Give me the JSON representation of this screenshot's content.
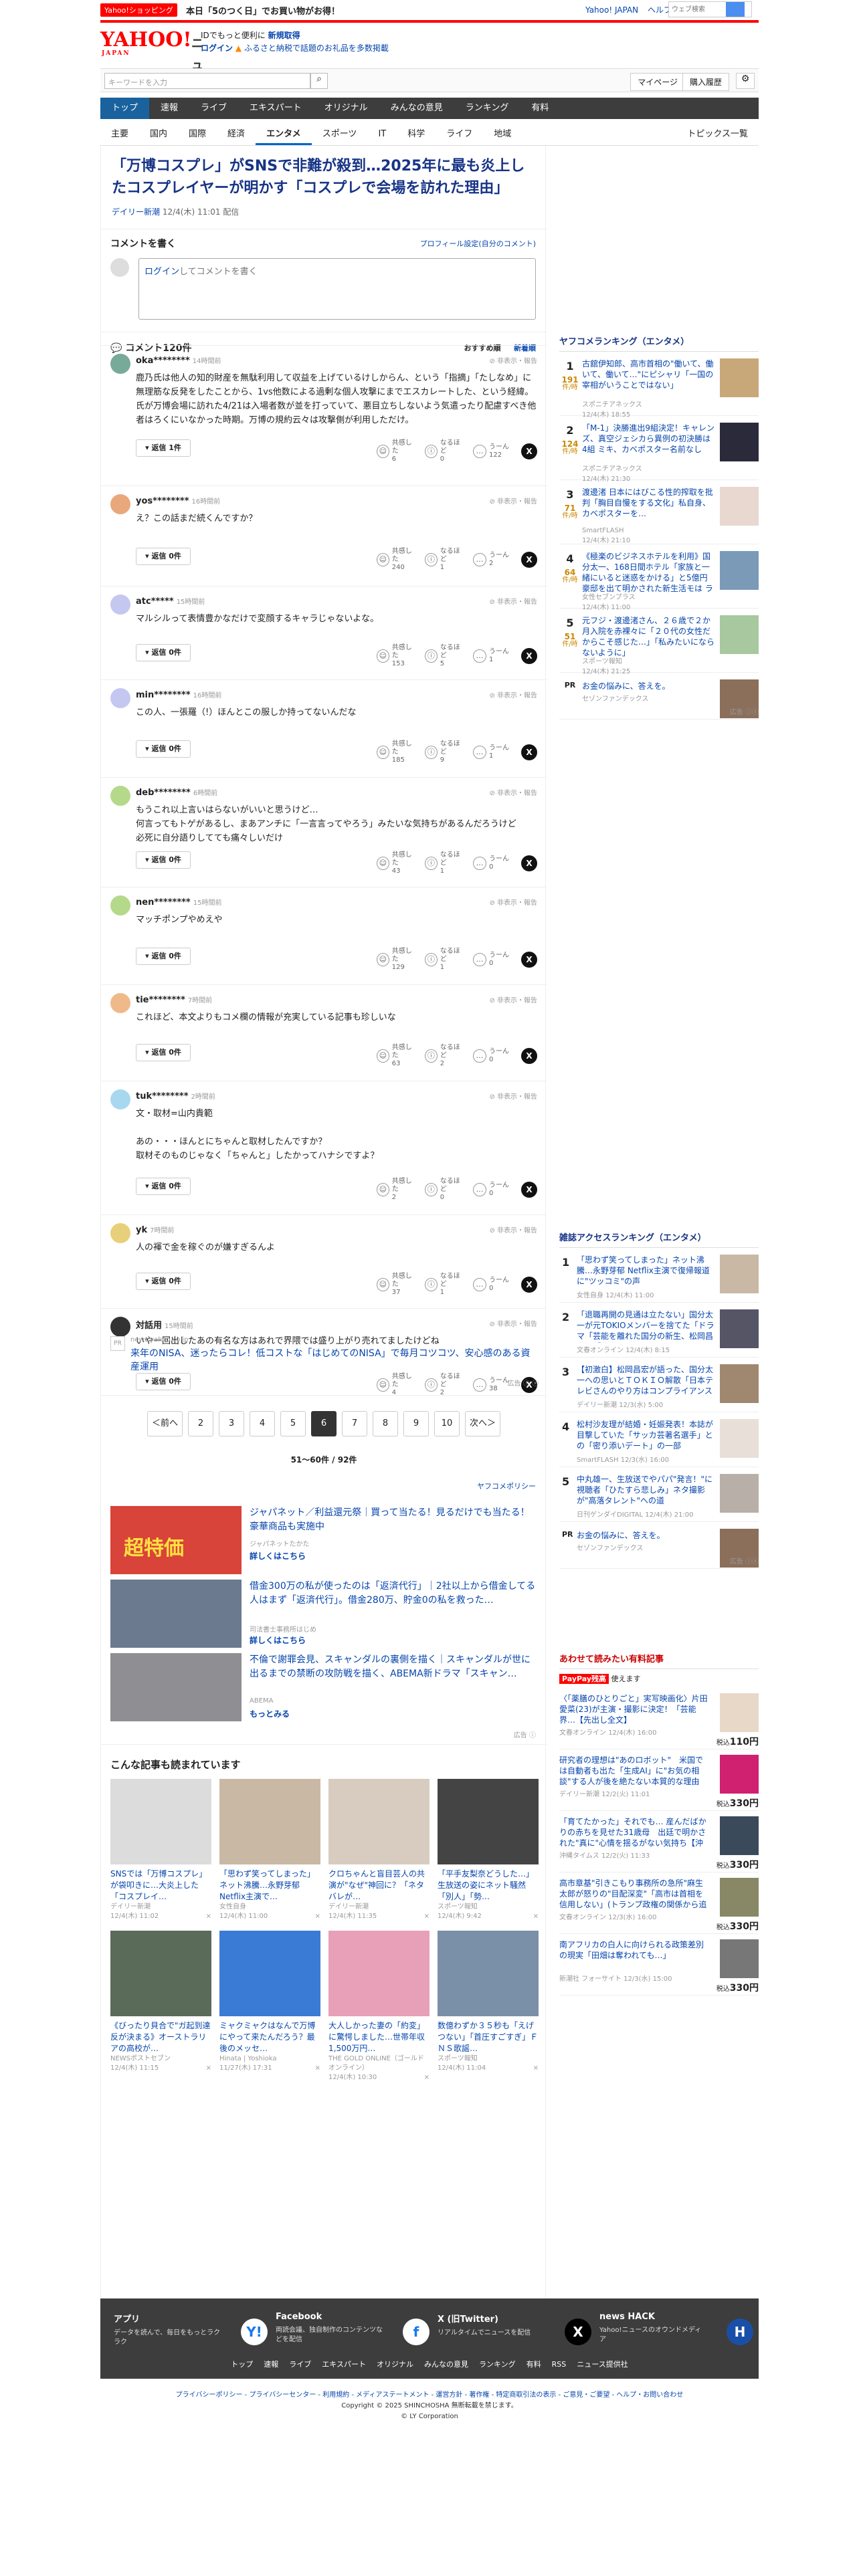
{
  "topbar": {
    "shopping_badge": "Yahoo!ショッピング",
    "shopping_text": "本日「5のつく日」でお買い物がお得！",
    "link_yahoo": "Yahoo! JAPAN",
    "link_help": "ヘルプ",
    "search_placeholder": "ウェブ検索",
    "location": "市川義範"
  },
  "logo": {
    "main": "YAHOO!",
    "sub": "JAPAN",
    "news": "ニュース"
  },
  "promo": {
    "line1a": "IDでもっと便利に",
    "line1b": "新規取得",
    "line2a": "ログイン",
    "line2b": "ふるさと納税で話題のお礼品を多数掲載"
  },
  "searchbar": {
    "placeholder": "キーワードを入力",
    "mypage": "マイページ",
    "purchased": "購入履歴"
  },
  "gnav": [
    "トップ",
    "速報",
    "ライブ",
    "エキスパート",
    "オリジナル",
    "みんなの意見",
    "ランキング",
    "有料"
  ],
  "subnav": [
    "主要",
    "国内",
    "国際",
    "経済",
    "エンタメ",
    "スポーツ",
    "IT",
    "科学",
    "ライフ",
    "地域"
  ],
  "subnav_right": "トピックス一覧",
  "article": {
    "headline": "「万博コスプレ」がSNSで非難が殺到…2025年に最も炎上したコスプレイヤーが明かす「コスプレで会場を訪れた理由」",
    "source": "デイリー新潮",
    "date": "12/4(木) 11:01 配信"
  },
  "comment_write": {
    "title": "コメントを書く",
    "profile_link": "プロフィール設定(自分のコメント)",
    "login_link": "ログイン",
    "placeholder": "してコメントを書く"
  },
  "comments_header": {
    "title": "コメント120件",
    "sort_recommended": "おすすめ順",
    "sort_new": "新着順"
  },
  "labels": {
    "report": "非表示・報告",
    "empathy": "共感した",
    "naruhodo": "なるほど",
    "hmm": "うーん"
  },
  "comments": [
    {
      "user": "oka********",
      "time": "14時間前",
      "text": "鹿乃氏は他人の知的財産を無駄利用して収益を上げているけしからん、という「指摘」「たしなめ」に無理筋な反発をしたことから、1vs他数による過剰な個人攻撃にまでエスカレートした、という経緯。氏が万博会場に訪れた4/21は入場者数が並を打っていて、悪目立ちしないよう気遣ったり配慮すべき他者はろくにいなかった時期。万博の規約云々は攻撃側が利用しただけ。",
      "reply": "返信 1件",
      "empathy": "6",
      "naruhodo": "0",
      "hmm": "122",
      "color": "#7a9"
    },
    {
      "user": "yos********",
      "time": "16時間前",
      "text": "え？この話まだ続くんですか？",
      "reply": "返信 0件",
      "empathy": "240",
      "naruhodo": "1",
      "hmm": "2",
      "color": "#e8a87c"
    },
    {
      "user": "atc*****",
      "time": "15時間前",
      "text": "マルシルって表情豊かなだけで変顔するキャラじゃないよな。",
      "reply": "返信 0件",
      "empathy": "153",
      "naruhodo": "5",
      "hmm": "1",
      "color": "#c4c8f0"
    },
    {
      "user": "min********",
      "time": "16時間前",
      "text": "この人、一張羅（!）ほんとこの服しか持ってないんだな",
      "reply": "返信 0件",
      "empathy": "185",
      "naruhodo": "9",
      "hmm": "1",
      "color": "#c4c8f0"
    },
    {
      "user": "deb********",
      "time": "6時間前",
      "text": "もうこれ以上言いはらないがいいと思うけど…\n何言ってもトゲがあるし、まあアンチに「一言言ってやろう」みたいな気持ちがあるんだろうけど\n必死に自分語りしてても痛々しいだけ",
      "reply": "返信 0件",
      "empathy": "43",
      "naruhodo": "1",
      "hmm": "0",
      "color": "#b5d98a"
    },
    {
      "user": "nen********",
      "time": "15時間前",
      "text": "マッチポンプやめえや",
      "reply": "返信 0件",
      "empathy": "129",
      "naruhodo": "1",
      "hmm": "0",
      "color": "#b5d98a"
    },
    {
      "user": "tie********",
      "time": "7時間前",
      "text": "これほど、本文よりもコメ欄の情報が充実している記事も珍しいな",
      "reply": "返信 0件",
      "empathy": "63",
      "naruhodo": "2",
      "hmm": "0",
      "color": "#f0b98a"
    },
    {
      "user": "tuk********",
      "time": "2時間前",
      "text": "文・取材=山内貴範\n\nあの・・・ほんとにちゃんと取材したんですか？\n取材そのものじゃなく「ちゃんと」したかってハナシですよ？",
      "reply": "返信 0件",
      "empathy": "2",
      "naruhodo": "0",
      "hmm": "0",
      "color": "#a8d8f0"
    },
    {
      "user": "yk",
      "time": "7時間前",
      "text": "人の褌で金を稼ぐのが嫌すぎるんよ",
      "reply": "返信 0件",
      "empathy": "37",
      "naruhodo": "1",
      "hmm": "0",
      "color": "#e8d07a"
    },
    {
      "user": "対話用",
      "time": "15時間前",
      "text": "いや一回出したあの有名な方はあれで界隈では盛り上がり売れてましたけどね",
      "reply": "返信 0件",
      "empathy": "4",
      "naruhodo": "2",
      "hmm": "38",
      "color": "#333"
    }
  ],
  "inline_ad": {
    "domain": "news.yahoo.co.jp",
    "text": "来年のNISA、迷ったらコレ！低コストな「はじめてのNISA」で毎月コツコツ、安心感のある資産運用",
    "label": "広告"
  },
  "pager": {
    "prev": "＜前へ",
    "pages": [
      "2",
      "3",
      "4",
      "5",
      "6",
      "7",
      "8",
      "9",
      "10"
    ],
    "current": "6",
    "next": "次へ＞",
    "count": "51〜60件 / 92件"
  },
  "ad_policy": "ヤフコメポリシー",
  "ads": [
    {
      "title": "ジャパネット／利益還元祭｜買って当たる！見るだけでも当たる！豪華商品も実施中",
      "source": "ジャパネットたかた",
      "link": "詳しくはこちら",
      "banner": "超特価",
      "color": "#d8433a"
    },
    {
      "title": "借金300万の私が使ったのは「返済代行」｜2社以上から借金してる人はまず「返済代行」。借金280万、貯金0の私を救った…",
      "source": "司法書士事務所はじめ",
      "link": "詳しくはこちら",
      "color": "#6b7a8f"
    },
    {
      "title": "不倫で謝罪会見、スキャンダルの裏側を描く｜スキャンダルが世に出るまでの禁断の攻防戦を描く、ABEMA新ドラマ「スキャン…",
      "source": "ABEMA",
      "link": "もっとみる",
      "color": "#8e8e93"
    }
  ],
  "recommended": {
    "title": "こんな記事も読まれています",
    "items": [
      {
        "title": "SNSでは「万博コスプレ」が袋叩きに…大炎上した「コスプレイ…",
        "source": "デイリー新潮",
        "date": "12/4(木) 11:02",
        "color": "#dcdcdc"
      },
      {
        "title": "「思わず笑ってしまった」ネット沸騰…永野芽郁 Netflix主演で…",
        "source": "女性自身",
        "date": "12/4(木) 11:00",
        "color": "#c9b8a4"
      },
      {
        "title": "クロちゃんと盲目芸人の共演が\"なぜ\"神回に？「ネタバレが…",
        "source": "デイリー新潮",
        "date": "12/4(木) 11:35",
        "color": "#d8ccc0"
      },
      {
        "title": "「平手友梨奈どうした…」生放送の姿にネット騒然「別人」「勢…",
        "source": "スポーツ報知",
        "date": "12/4(木) 9:42",
        "color": "#444"
      },
      {
        "title": "《びったり貝合で\"ガ起到達反が決まる》オーストラリアの高校が…",
        "source": "NEWSポストセブン",
        "date": "12/4(木) 11:15",
        "color": "#5a6b5a"
      },
      {
        "title": "ミャクミャクはなんで万博にやって来たんだろう？最後のメッセ…",
        "source": "Hinata | Yoshioka",
        "date": "11/27(木) 17:31",
        "color": "#3a7bd5"
      },
      {
        "title": "大人しかった妻の「約変」に驚愕しました…世帯年収1,500万円…",
        "source": "THE GOLD ONLINE（ゴールドオンライン）",
        "date": "12/4(木) 10:30",
        "color": "#e8a0b8"
      },
      {
        "title": "数億わずか３５秒も「えげつない」「首圧すごすぎ」ＦＮＳ歌謡…",
        "source": "スポーツ報知",
        "date": "12/4(木) 11:04",
        "color": "#7a8fa8"
      }
    ]
  },
  "ranking": {
    "title": "ヤフコメランキング（エンタメ）",
    "items": [
      {
        "num": "1",
        "count": "191",
        "unit": "件/時",
        "title": "古舘伊知郎、高市首相の\"働いて、働いて、働いて…\"にピシャリ「一国の宰相がいうことではない」",
        "source": "スポニチアネックス",
        "date": "12/4(木) 18:55",
        "color": "#c8a878"
      },
      {
        "num": "2",
        "count": "124",
        "unit": "件/時",
        "title": "「M-1」決勝進出9組決定！キャレンズ、真空ジェシカら異例の初決勝は4組 ミキ、カベポスター名前なし",
        "source": "スポニチアネックス",
        "date": "12/4(木) 21:30",
        "color": "#2a2a3a"
      },
      {
        "num": "3",
        "count": "71",
        "unit": "件/時",
        "title": "渡邊渚 日本にはびこる性的搾取を批判「胸目自慢をする文化」私自身、カベポスターを…",
        "source": "SmartFLASH",
        "date": "12/4(木) 21:10",
        "color": "#e8d8d0"
      },
      {
        "num": "4",
        "count": "64",
        "unit": "件/時",
        "title": "《極楽のビジネスホテルを利用》国分太一、168日間ホテル「家族と一緒にいると迷惑をかける」と5億円豪邸を出て明かされた新生活モは ラブホ街での目撃情報も",
        "source": "女性セブンプラス",
        "date": "12/4(木) 11:00",
        "color": "#7a9ab8"
      },
      {
        "num": "5",
        "count": "51",
        "unit": "件/時",
        "title": "元フジ・渡邊渚さん、２６歳で２か月入院を赤裸々に「２０代の女性だからこそ感じた…」「私みたいにならないように」",
        "source": "スポーツ報知",
        "date": "12/4(木) 21:25",
        "color": "#a8c8a0"
      }
    ],
    "pr": {
      "title": "お金の悩みに、答えを。",
      "source": "セゾンファンデックス",
      "label": "PR",
      "ad": "広告"
    }
  },
  "magazine": {
    "title": "雑誌アクセスランキング（エンタメ）",
    "items": [
      {
        "num": "1",
        "title": "「思わず笑ってしまった」ネット沸騰…永野芽郁 Netflix主演で復帰報道に\"ツッコミ\"の声",
        "source": "女性自身",
        "date": "12/4(木) 11:00",
        "color": "#c9b8a4"
      },
      {
        "num": "2",
        "title": "「退職再開の見通は立たない」国分太一が元TOKIOメンバーを捨てた「ドラマ「芸能を離れた国分の新生、松岡昌宏は「将来のことを…",
        "source": "文春オンライン",
        "date": "12/4(木) 8:15",
        "color": "#556"
      },
      {
        "num": "3",
        "title": "【初激白】松岡昌宏が語った、国分太一への思いとＴＯＫＩＯ解散「日本テレビさんのやり方はコンプライアンス違反ではないのか」",
        "source": "デイリー新潮",
        "date": "12/3(水) 5:00",
        "color": "#a08870"
      },
      {
        "num": "4",
        "title": "松村沙友理が結婚・妊娠発表！本誌が目撃していた「サッカ芸著名選手」との「密り添いデート」の一部",
        "source": "SmartFLASH",
        "date": "12/3(水) 16:00",
        "color": "#e8e0d8"
      },
      {
        "num": "5",
        "title": "中丸雄一、生放送でやパパ\"発言！\"に視聴者「ひたすら悲しみ」ネタ撮影が\"高落タレント\"への道",
        "source": "日刊ゲンダイDIGITAL",
        "date": "12/4(木) 21:00",
        "color": "#b8b0a8"
      }
    ],
    "pr": {
      "title": "お金の悩みに、答えを。",
      "source": "セゾンファンデックス",
      "label": "PR",
      "ad": "広告"
    }
  },
  "shop": {
    "title": "あわせて読みたい有料記事",
    "badge": "PayPay残高",
    "badge_text": "使えます",
    "price_label": "税込",
    "items": [
      {
        "title": "〈「薬膳のひとりごと」実写映画化〉片田愛菜(23)が主演・撮影に決定！「芸能界…【先出し全文】",
        "source": "文春オンライン",
        "date": "12/4(木) 16:00",
        "price": "110円",
        "color": "#e8d8c8"
      },
      {
        "title": "研究者の理想は\"あのロボット\"　米国では自動者も出た「生成AI」に\"お気の相談\"する人が後を絶たない本質的な理由",
        "source": "デイリー新潮",
        "date": "12/2(火) 11:01",
        "price": "330円",
        "color": "#d02070"
      },
      {
        "title": "「育てたかった」それでも… 産んだばかりの赤ちを見せた31歳母　出廷で明かされた\"真に\"心情を揺るがない気持ち【沖縄市新生児殺害事件】",
        "source": "沖縄タイムス",
        "date": "12/2(火) 11:33",
        "price": "330円",
        "color": "#3a4a5a"
      },
      {
        "title": "高市章基\"引きこもり事務所の急所\"麻生太郎が怒りの\"目配深変\"「高市は首相を信用しない」(トランプ政権の関係から追い込む方法)に言葉を…【先出し全文】",
        "source": "文春オンライン",
        "date": "12/3(水) 16:00",
        "price": "330円",
        "color": "#886"
      },
      {
        "title": "南アフリカの白人に向けられる政策差別の現実「田畑は奪われても…」",
        "source": "新潮社 フォーサイト",
        "date": "12/3(水) 15:00",
        "price": "330円",
        "color": "#777"
      }
    ]
  },
  "footer": {
    "cols": [
      {
        "title": "アプリ",
        "desc": "データを読んで、毎日をもっとラクラク",
        "icon": "Y!"
      },
      {
        "title": "Facebook",
        "desc": "両読会議、独自制作のコンテンツなどを配信",
        "icon": "f"
      },
      {
        "title": "X (旧Twitter)",
        "desc": "リアルタイムでニュースを配信",
        "icon": "X"
      },
      {
        "title": "news HACK",
        "desc": "Yahoo!ニュースのオウンドメディア",
        "icon": "H"
      }
    ],
    "nav": [
      "トップ",
      "速報",
      "ライブ",
      "エキスパート",
      "オリジナル",
      "みんなの意見",
      "ランキング",
      "有料",
      "RSS",
      "ニュース提供社"
    ],
    "legal": "プライバシーポリシー - プライバシーセンター - 利用規約 - メディアステートメント - 運営方針 - 著作権 - 特定商取引法の表示 - ご意見・ご要望 - ヘルプ・お問い合わせ",
    "copyright1": "Copyright © 2025 SHINCHOSHA 無断転載を禁じます。",
    "copyright2": "© LY Corporation"
  }
}
